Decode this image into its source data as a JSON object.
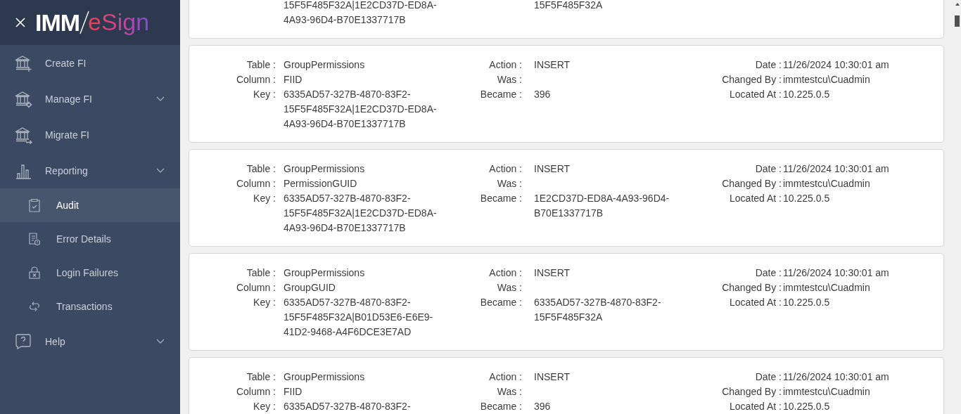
{
  "logo": {
    "first": "IMM",
    "second": "eSign"
  },
  "nav": [
    {
      "label": "Create FI",
      "expandable": false
    },
    {
      "label": "Manage FI",
      "expandable": true
    },
    {
      "label": "Migrate FI",
      "expandable": false
    },
    {
      "label": "Reporting",
      "expandable": true,
      "children": [
        {
          "label": "Audit",
          "selected": true
        },
        {
          "label": "Error Details",
          "selected": false
        },
        {
          "label": "Login Failures",
          "selected": false
        },
        {
          "label": "Transactions",
          "selected": false
        }
      ]
    },
    {
      "label": "Help",
      "expandable": true
    }
  ],
  "cards": [
    {
      "kind": "partial-top",
      "left": [
        {
          "value": "15F5F485F32A|1E2CD37D-ED8A-4A93-96D4-B70E1337717B"
        }
      ],
      "middle": [
        {
          "value": "15F5F485F32A"
        }
      ]
    },
    {
      "kind": "full",
      "left": [
        {
          "label": "Table :",
          "value": "GroupPermissions"
        },
        {
          "label": "Column :",
          "value": "FIID"
        },
        {
          "label": "Key :",
          "value": "6335AD57-327B-4870-83F2-15F5F485F32A|1E2CD37D-ED8A-4A93-96D4-B70E1337717B"
        }
      ],
      "middle": [
        {
          "label": "Action :",
          "value": "INSERT"
        },
        {
          "label": "Was :"
        },
        {
          "label": "Became :",
          "value": "396"
        }
      ],
      "right": [
        {
          "label": "Date :",
          "value": "11/26/2024 10:30:01 am"
        },
        {
          "label": "Changed By :",
          "value": "immtestcu\\Cuadmin"
        },
        {
          "label": "Located At :",
          "value": "10.225.0.5"
        }
      ]
    },
    {
      "kind": "full",
      "left": [
        {
          "label": "Table :",
          "value": "GroupPermissions"
        },
        {
          "label": "Column :",
          "value": "PermissionGUID"
        },
        {
          "label": "Key :",
          "value": "6335AD57-327B-4870-83F2-15F5F485F32A|1E2CD37D-ED8A-4A93-96D4-B70E1337717B"
        }
      ],
      "middle": [
        {
          "label": "Action :",
          "value": "INSERT"
        },
        {
          "label": "Was :"
        },
        {
          "label": "Became :",
          "value": "1E2CD37D-ED8A-4A93-96D4-B70E1337717B"
        }
      ],
      "right": [
        {
          "label": "Date :",
          "value": "11/26/2024 10:30:01 am"
        },
        {
          "label": "Changed By :",
          "value": "immtestcu\\Cuadmin"
        },
        {
          "label": "Located At :",
          "value": "10.225.0.5"
        }
      ]
    },
    {
      "kind": "full",
      "left": [
        {
          "label": "Table :",
          "value": "GroupPermissions"
        },
        {
          "label": "Column :",
          "value": "GroupGUID"
        },
        {
          "label": "Key :",
          "value": "6335AD57-327B-4870-83F2-15F5F485F32A|B01D53E6-E6E9-41D2-9468-A4F6DCE3E7AD"
        }
      ],
      "middle": [
        {
          "label": "Action :",
          "value": "INSERT"
        },
        {
          "label": "Was :"
        },
        {
          "label": "Became :",
          "value": "6335AD57-327B-4870-83F2-15F5F485F32A"
        }
      ],
      "right": [
        {
          "label": "Date :",
          "value": "11/26/2024 10:30:01 am"
        },
        {
          "label": "Changed By :",
          "value": "immtestcu\\Cuadmin"
        },
        {
          "label": "Located At :",
          "value": "10.225.0.5"
        }
      ]
    },
    {
      "kind": "partial-bottom",
      "left": [
        {
          "label": "Table :",
          "value": "GroupPermissions"
        },
        {
          "label": "Column :",
          "value": "FIID"
        },
        {
          "label": "Key :",
          "value": "6335AD57-327B-4870-83F2-"
        }
      ],
      "middle": [
        {
          "label": "Action :",
          "value": "INSERT"
        },
        {
          "label": "Was :"
        },
        {
          "label": "Became :",
          "value": "396"
        }
      ],
      "right": [
        {
          "label": "Date :",
          "value": "11/26/2024 10:30:01 am"
        },
        {
          "label": "Changed By :",
          "value": "immtestcu\\Cuadmin"
        },
        {
          "label": "Located At :",
          "value": "10.225.0.5"
        }
      ]
    }
  ]
}
